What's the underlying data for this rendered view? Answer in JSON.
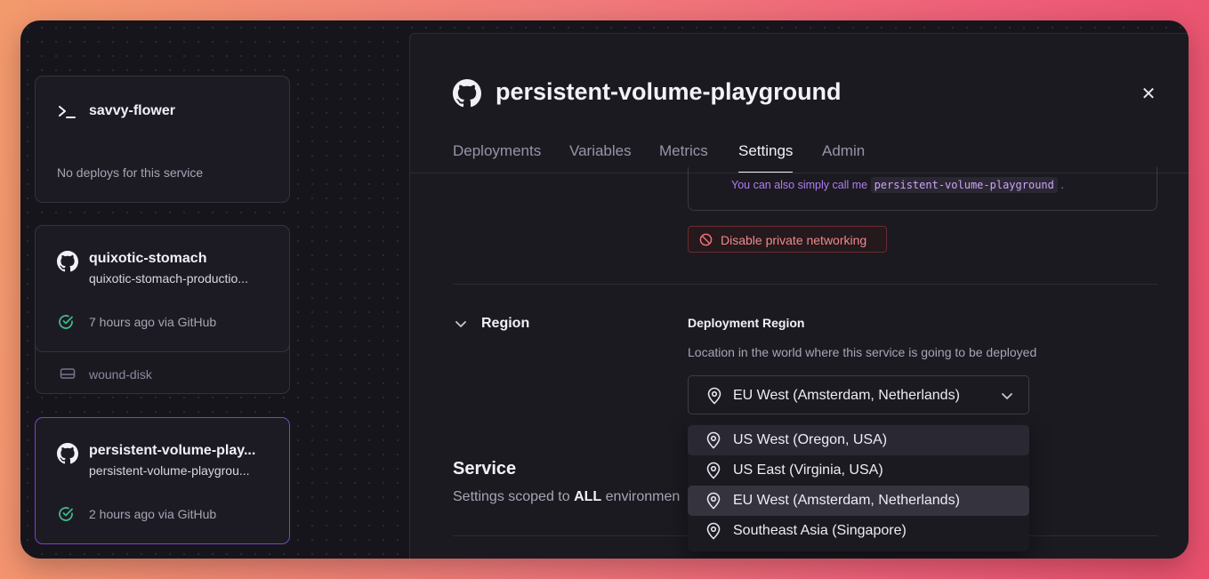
{
  "sidebar": {
    "cards": [
      {
        "title": "savvy-flower",
        "status": "No deploys for this service"
      },
      {
        "title": "quixotic-stomach",
        "subtitle": "quixotic-stomach-productio...",
        "status": "7 hours ago via GitHub",
        "volume": "wound-disk"
      },
      {
        "title": "persistent-volume-play...",
        "subtitle": "persistent-volume-playgrou...",
        "status": "2 hours ago via GitHub"
      }
    ]
  },
  "panel": {
    "title": "persistent-volume-playground",
    "tabs": [
      "Deployments",
      "Variables",
      "Metrics",
      "Settings",
      "Admin"
    ],
    "active_tab": "Settings",
    "networking": {
      "alias_prefix": "You can also simply call me",
      "alias_code": "persistent-volume-playground",
      "alias_suffix": ".",
      "disable_button": "Disable private networking"
    },
    "region": {
      "section_title": "Region",
      "label": "Deployment Region",
      "description": "Location in the world where this service is going to be deployed",
      "selected": "EU West (Amsterdam, Netherlands)",
      "options": [
        "US West (Oregon, USA)",
        "US East (Virginia, USA)",
        "EU West (Amsterdam, Netherlands)",
        "Southeast Asia (Singapore)"
      ]
    },
    "service": {
      "title": "Service",
      "desc_prefix": "Settings scoped to",
      "desc_bold": "ALL",
      "desc_suffix": "environmen"
    }
  },
  "colors": {
    "accent_purple": "#b07cf0",
    "success_green": "#3fb98a",
    "danger_red": "#ef8a8e"
  }
}
